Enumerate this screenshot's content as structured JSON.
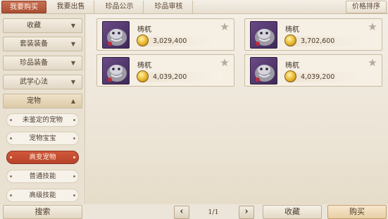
{
  "tabs": [
    {
      "label": "我要购买",
      "active": true
    },
    {
      "label": "我要出售"
    },
    {
      "label": "珍品公示"
    },
    {
      "label": "珍品审核"
    }
  ],
  "price_sort_label": "价格排序",
  "sidebar": {
    "categories": [
      {
        "label": "收藏",
        "arrow": "▼"
      },
      {
        "label": "套装装备",
        "arrow": "▼"
      },
      {
        "label": "珍品装备",
        "arrow": "▼"
      },
      {
        "label": "武学心法",
        "arrow": "▼"
      },
      {
        "label": "宠物",
        "arrow": "▲",
        "expanded": true
      }
    ],
    "subitems": [
      {
        "label": "未鉴定的宠物"
      },
      {
        "label": "宠物宝宝"
      },
      {
        "label": "高变宠物",
        "active": true
      },
      {
        "label": "普通技能"
      },
      {
        "label": "高级技能"
      }
    ]
  },
  "items": [
    {
      "name": "梼杌",
      "price": "3,029,400",
      "icon": "taowu-pet-icon"
    },
    {
      "name": "梼杌",
      "price": "3,702,600",
      "icon": "taowu-pet-icon"
    },
    {
      "name": "梼杌",
      "price": "4,039,200",
      "icon": "taowu-pet-icon"
    },
    {
      "name": "梼杌",
      "price": "4,039,200",
      "icon": "taowu-pet-icon"
    }
  ],
  "bottom": {
    "search_label": "搜索",
    "prev_label": "‹",
    "next_label": "›",
    "page": "1/1",
    "favorite_label": "收藏",
    "buy_label": "购买"
  },
  "colors": {
    "active_tab": "#b8553a",
    "active_subitem": "#c24d31",
    "coin": "#e6b52a"
  }
}
